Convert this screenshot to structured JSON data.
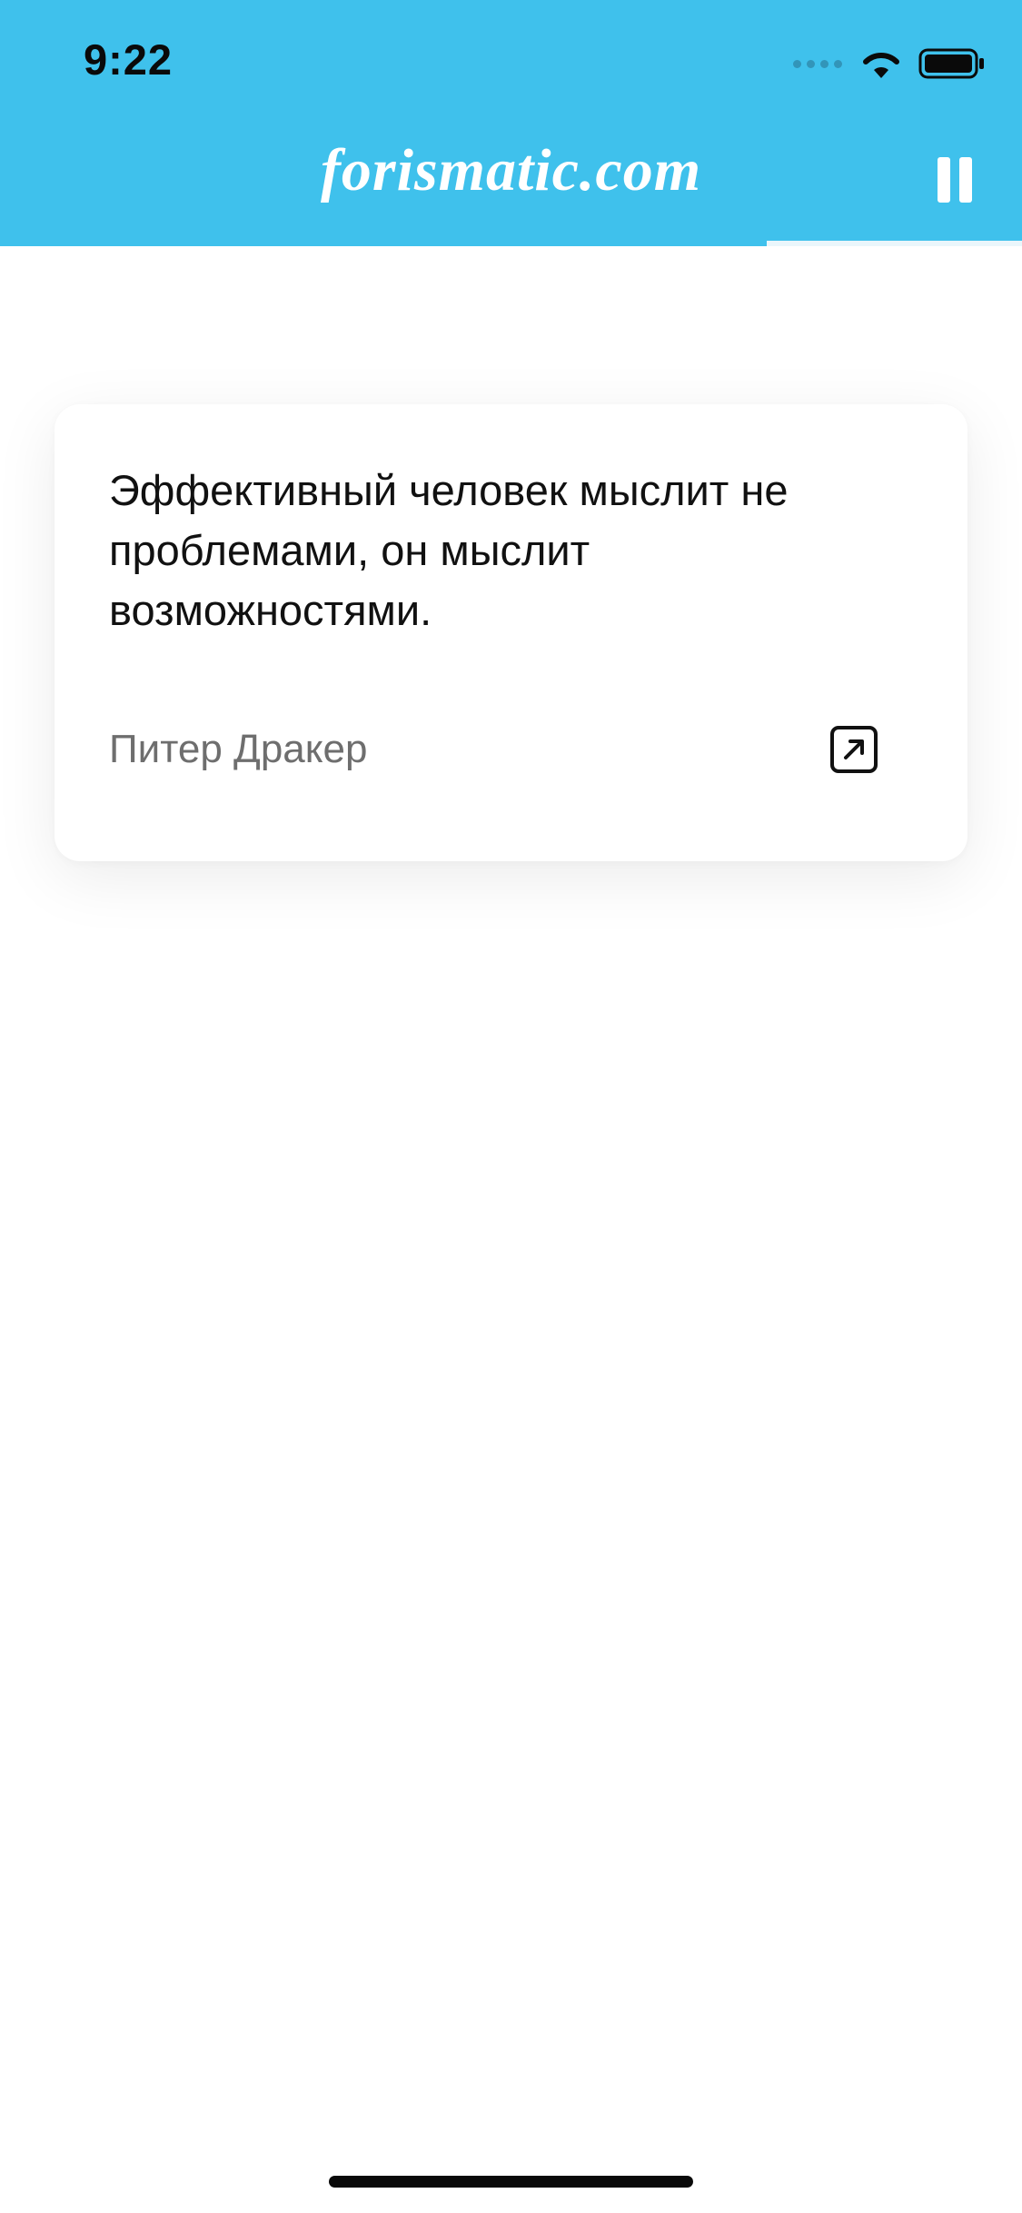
{
  "status_bar": {
    "time": "9:22",
    "icons": [
      "cellular-signal-icon",
      "wifi-icon",
      "battery-icon"
    ]
  },
  "header": {
    "brand_title": "forismatic.com",
    "pause_icon": "pause-icon",
    "background_color": "#3fc1ec"
  },
  "progress": {
    "value_percent": 75
  },
  "quote": {
    "text": "Эффективный человек мыслит не проблемами, он мыслит возможностями.",
    "author": "Питер Дракер",
    "share_icon": "open-external-icon"
  }
}
